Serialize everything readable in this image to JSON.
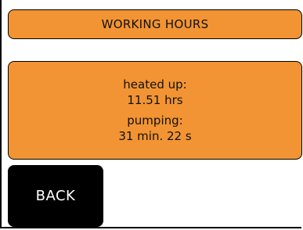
{
  "header": {
    "title": "WORKING HOURS"
  },
  "stats": {
    "heated_label": "heated up:",
    "heated_value": "11.51 hrs",
    "pumping_label": "pumping:",
    "pumping_value": "31 min. 22 s"
  },
  "buttons": {
    "back_label": "BACK"
  },
  "colors": {
    "panel": "#f29433",
    "button": "#000000",
    "background": "#ffffff"
  }
}
